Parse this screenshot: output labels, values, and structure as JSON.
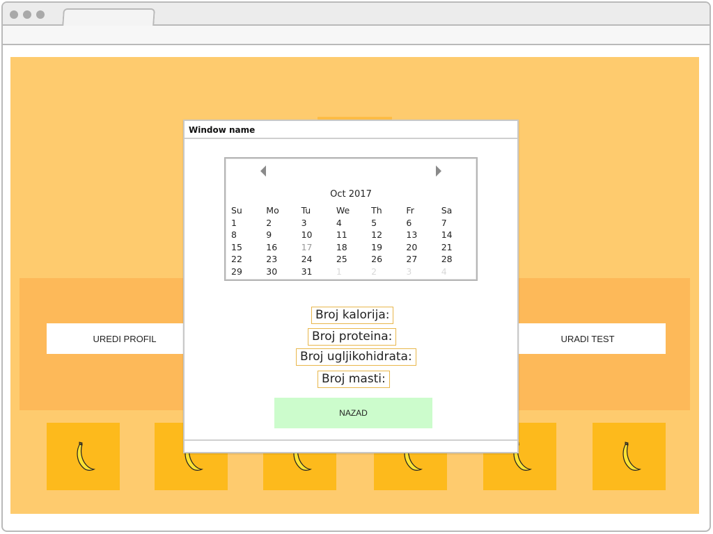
{
  "page": {
    "menu": {
      "left_label": "UREDI PROFIL",
      "right_label": "URADI TEST"
    },
    "tiles": [
      {
        "icon": "banana-icon"
      },
      {
        "icon": "banana-icon"
      },
      {
        "icon": "banana-icon"
      },
      {
        "icon": "banana-icon"
      },
      {
        "icon": "banana-icon"
      },
      {
        "icon": "banana-icon"
      }
    ]
  },
  "modal": {
    "title": "Window name",
    "calendar": {
      "month_label": "Oct  2017",
      "weekdays": [
        "Su",
        "Mo",
        "Tu",
        "We",
        "Th",
        "Fr",
        "Sa"
      ],
      "days": [
        [
          "1",
          "2",
          "3",
          "4",
          "5",
          "6",
          "7"
        ],
        [
          "8",
          "9",
          "10",
          "11",
          "12",
          "13",
          "14"
        ],
        [
          "15",
          "16",
          "17",
          "18",
          "19",
          "20",
          "21"
        ],
        [
          "22",
          "23",
          "24",
          "25",
          "26",
          "27",
          "28"
        ],
        [
          "29",
          "30",
          "31",
          "1",
          "2",
          "3",
          "4"
        ]
      ],
      "today": "17",
      "outside_days": [
        "1",
        "2",
        "3",
        "4"
      ]
    },
    "stats": {
      "calories": "Broj kalorija:",
      "protein": "Broj proteina:",
      "carbs": "Broj ugljikohidrata:",
      "fat": "Broj masti:"
    },
    "back_label": "NAZAD"
  },
  "colors": {
    "page_bg": "#fecb6e",
    "band": "#fdb959",
    "tile": "#fdba1c",
    "back_button": "#ccfccc",
    "stat_border": "#e8b64a"
  }
}
